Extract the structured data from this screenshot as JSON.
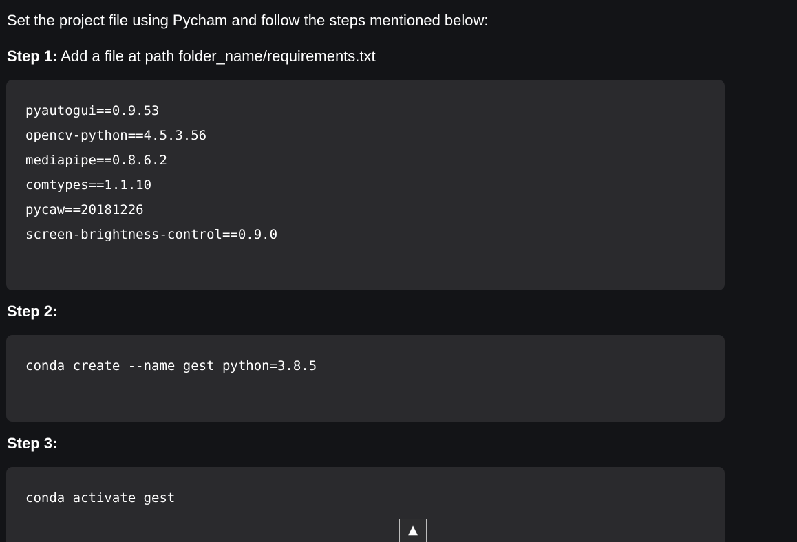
{
  "intro": "Set the project file using Pycham and follow the steps mentioned below:",
  "steps": [
    {
      "label": "Step 1:",
      "text": " Add a file at path folder_name/requirements.txt",
      "code_lines": [
        "pyautogui==0.9.53",
        "opencv-python==4.5.3.56",
        "mediapipe==0.8.6.2",
        "comtypes==1.1.10",
        "pycaw==20181226",
        "screen-brightness-control==0.9.0"
      ]
    },
    {
      "label": "Step 2:",
      "text": "",
      "code_lines": [
        "conda create --name gest python=3.8.5"
      ]
    },
    {
      "label": "Step 3:",
      "text": "",
      "code_lines": [
        "conda activate gest"
      ]
    }
  ],
  "scroll_top": {
    "icon": "arrow-up-icon",
    "glyph": "▲"
  }
}
